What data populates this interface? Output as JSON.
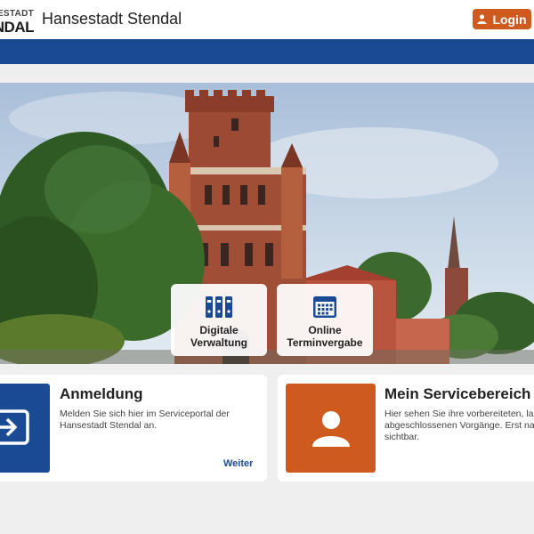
{
  "header": {
    "logo_line1": "ESTADT",
    "logo_line2": "NDAL",
    "title": "Hansestadt Stendal",
    "login_label": "Login"
  },
  "tiles": [
    {
      "label_line1": "Digitale",
      "label_line2": "Verwaltung",
      "icon": "binders-icon"
    },
    {
      "label_line1": "Online",
      "label_line2": "Terminvergabe",
      "icon": "calendar-icon"
    }
  ],
  "cards": [
    {
      "title": "Anmeldung",
      "text": "Melden Sie sich hier im Serviceportal der Hansestadt Stendal an.",
      "link": "Weiter",
      "icon": "login-arrow-icon"
    },
    {
      "title": "Mein Servicebereich",
      "text": "Hier sehen Sie ihre vorbereiteten, laufe abgeschlossenen Vorgänge. Erst nach sichtbar.",
      "icon": "user-icon"
    }
  ],
  "colors": {
    "primary_blue": "#194a93",
    "accent_orange": "#cf5a1e",
    "background": "#efefef"
  }
}
